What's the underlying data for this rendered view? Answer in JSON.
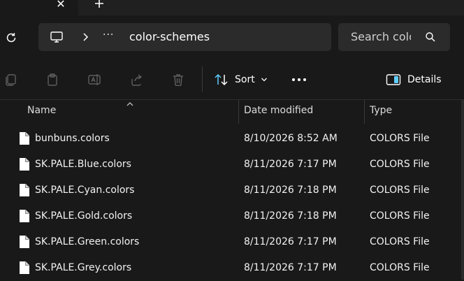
{
  "titlebar": {
    "tab_close": "✕",
    "new_tab": "+"
  },
  "address": {
    "overflow": "···",
    "folder": "color-schemes"
  },
  "search": {
    "placeholder": "Search color-schemes"
  },
  "toolbar": {
    "sort_label": "Sort",
    "more_label": "•••",
    "details_label": "Details"
  },
  "columns": {
    "name": "Name",
    "date": "Date modified",
    "type": "Type"
  },
  "files": [
    {
      "name": "bunbuns.colors",
      "date": "8/10/2026 8:52 AM",
      "type": "COLORS File"
    },
    {
      "name": "SK.PALE.Blue.colors",
      "date": "8/11/2026 7:17 PM",
      "type": "COLORS File"
    },
    {
      "name": "SK.PALE.Cyan.colors",
      "date": "8/11/2026 7:18 PM",
      "type": "COLORS File"
    },
    {
      "name": "SK.PALE.Gold.colors",
      "date": "8/11/2026 7:18 PM",
      "type": "COLORS File"
    },
    {
      "name": "SK.PALE.Green.colors",
      "date": "8/11/2026 7:17 PM",
      "type": "COLORS File"
    },
    {
      "name": "SK.PALE.Grey.colors",
      "date": "8/11/2026 7:17 PM",
      "type": "COLORS File"
    }
  ],
  "colors": {
    "background": "#191919",
    "address_bg": "#2b2b2b",
    "disabled_icon": "#5f5f5f",
    "accent": "#60cdff"
  }
}
